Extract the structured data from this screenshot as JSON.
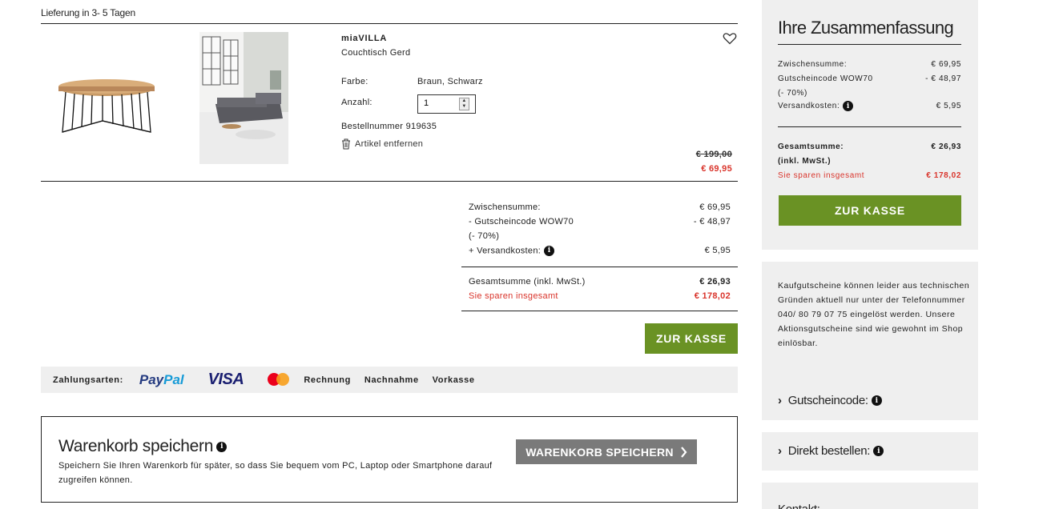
{
  "delivery": "Lieferung in 3- 5 Tagen",
  "product": {
    "brand": "miaVILLA",
    "name": "Couchtisch Gerd",
    "color_label": "Farbe:",
    "color_value": "Braun, Schwarz",
    "qty_label": "Anzahl:",
    "qty_value": "1",
    "order_number": "Bestellnummer  919635",
    "remove_label": "Artikel entfernen",
    "old_price": "€ 199,00",
    "new_price": "€ 69,95",
    "wishlist_icon": "heart-icon",
    "remove_icon": "trash-icon"
  },
  "summary": {
    "subtotal_label": "Zwischensumme:",
    "subtotal_value": "€ 69,95",
    "voucher_label": "- Gutscheincode WOW70",
    "voucher_value": "- € 48,97",
    "voucher_percent": "(- 70%)",
    "shipping_label": "+ Versandkosten:",
    "shipping_value": "€ 5,95",
    "total_label": "Gesamtsumme (inkl. MwSt.)",
    "total_value": "€ 26,93",
    "saved_label": "Sie sparen insgesamt",
    "saved_value": "€ 178,02"
  },
  "checkout_label": "ZUR KASSE",
  "payment": {
    "label": "Zahlungsarten:",
    "paypal_a": "Pay",
    "paypal_b": "Pal",
    "visa": "VISA",
    "methods": [
      "Rechnung",
      "Nachnahme",
      "Vorkasse"
    ]
  },
  "save_cart": {
    "title": "Warenkorb speichern",
    "description": "Speichern Sie Ihren Warenkorb für später, so dass Sie bequem vom PC, Laptop oder Smartphone darauf zugreifen können.",
    "button": "WARENKORB SPEICHERN"
  },
  "sidebar": {
    "title": "Ihre Zusammenfassung",
    "subtotal_label": "Zwischensumme:",
    "subtotal_value": "€ 69,95",
    "voucher_label": "Gutscheincode WOW70",
    "voucher_value": "- € 48,97",
    "voucher_percent": "(- 70%)",
    "shipping_label": "Versandkosten:",
    "shipping_value": "€ 5,95",
    "total_label": "Gesamtsumme:",
    "total_sub": "(inkl. MwSt.)",
    "total_value": "€ 26,93",
    "saved_label": "Sie sparen insgesamt",
    "saved_value": "€ 178,02",
    "notice": "Kaufgutscheine können leider aus technischen Gründen aktuell nur unter der Telefonnummer 040/ 80 79 07 75 eingelöst werden. Unsere Aktionsgutscheine sind wie gewohnt im Shop einlösbar.",
    "voucher_link": "Gutscheincode:",
    "direct_link": "Direkt bestellen:",
    "contact_link": "Kontakt:"
  }
}
